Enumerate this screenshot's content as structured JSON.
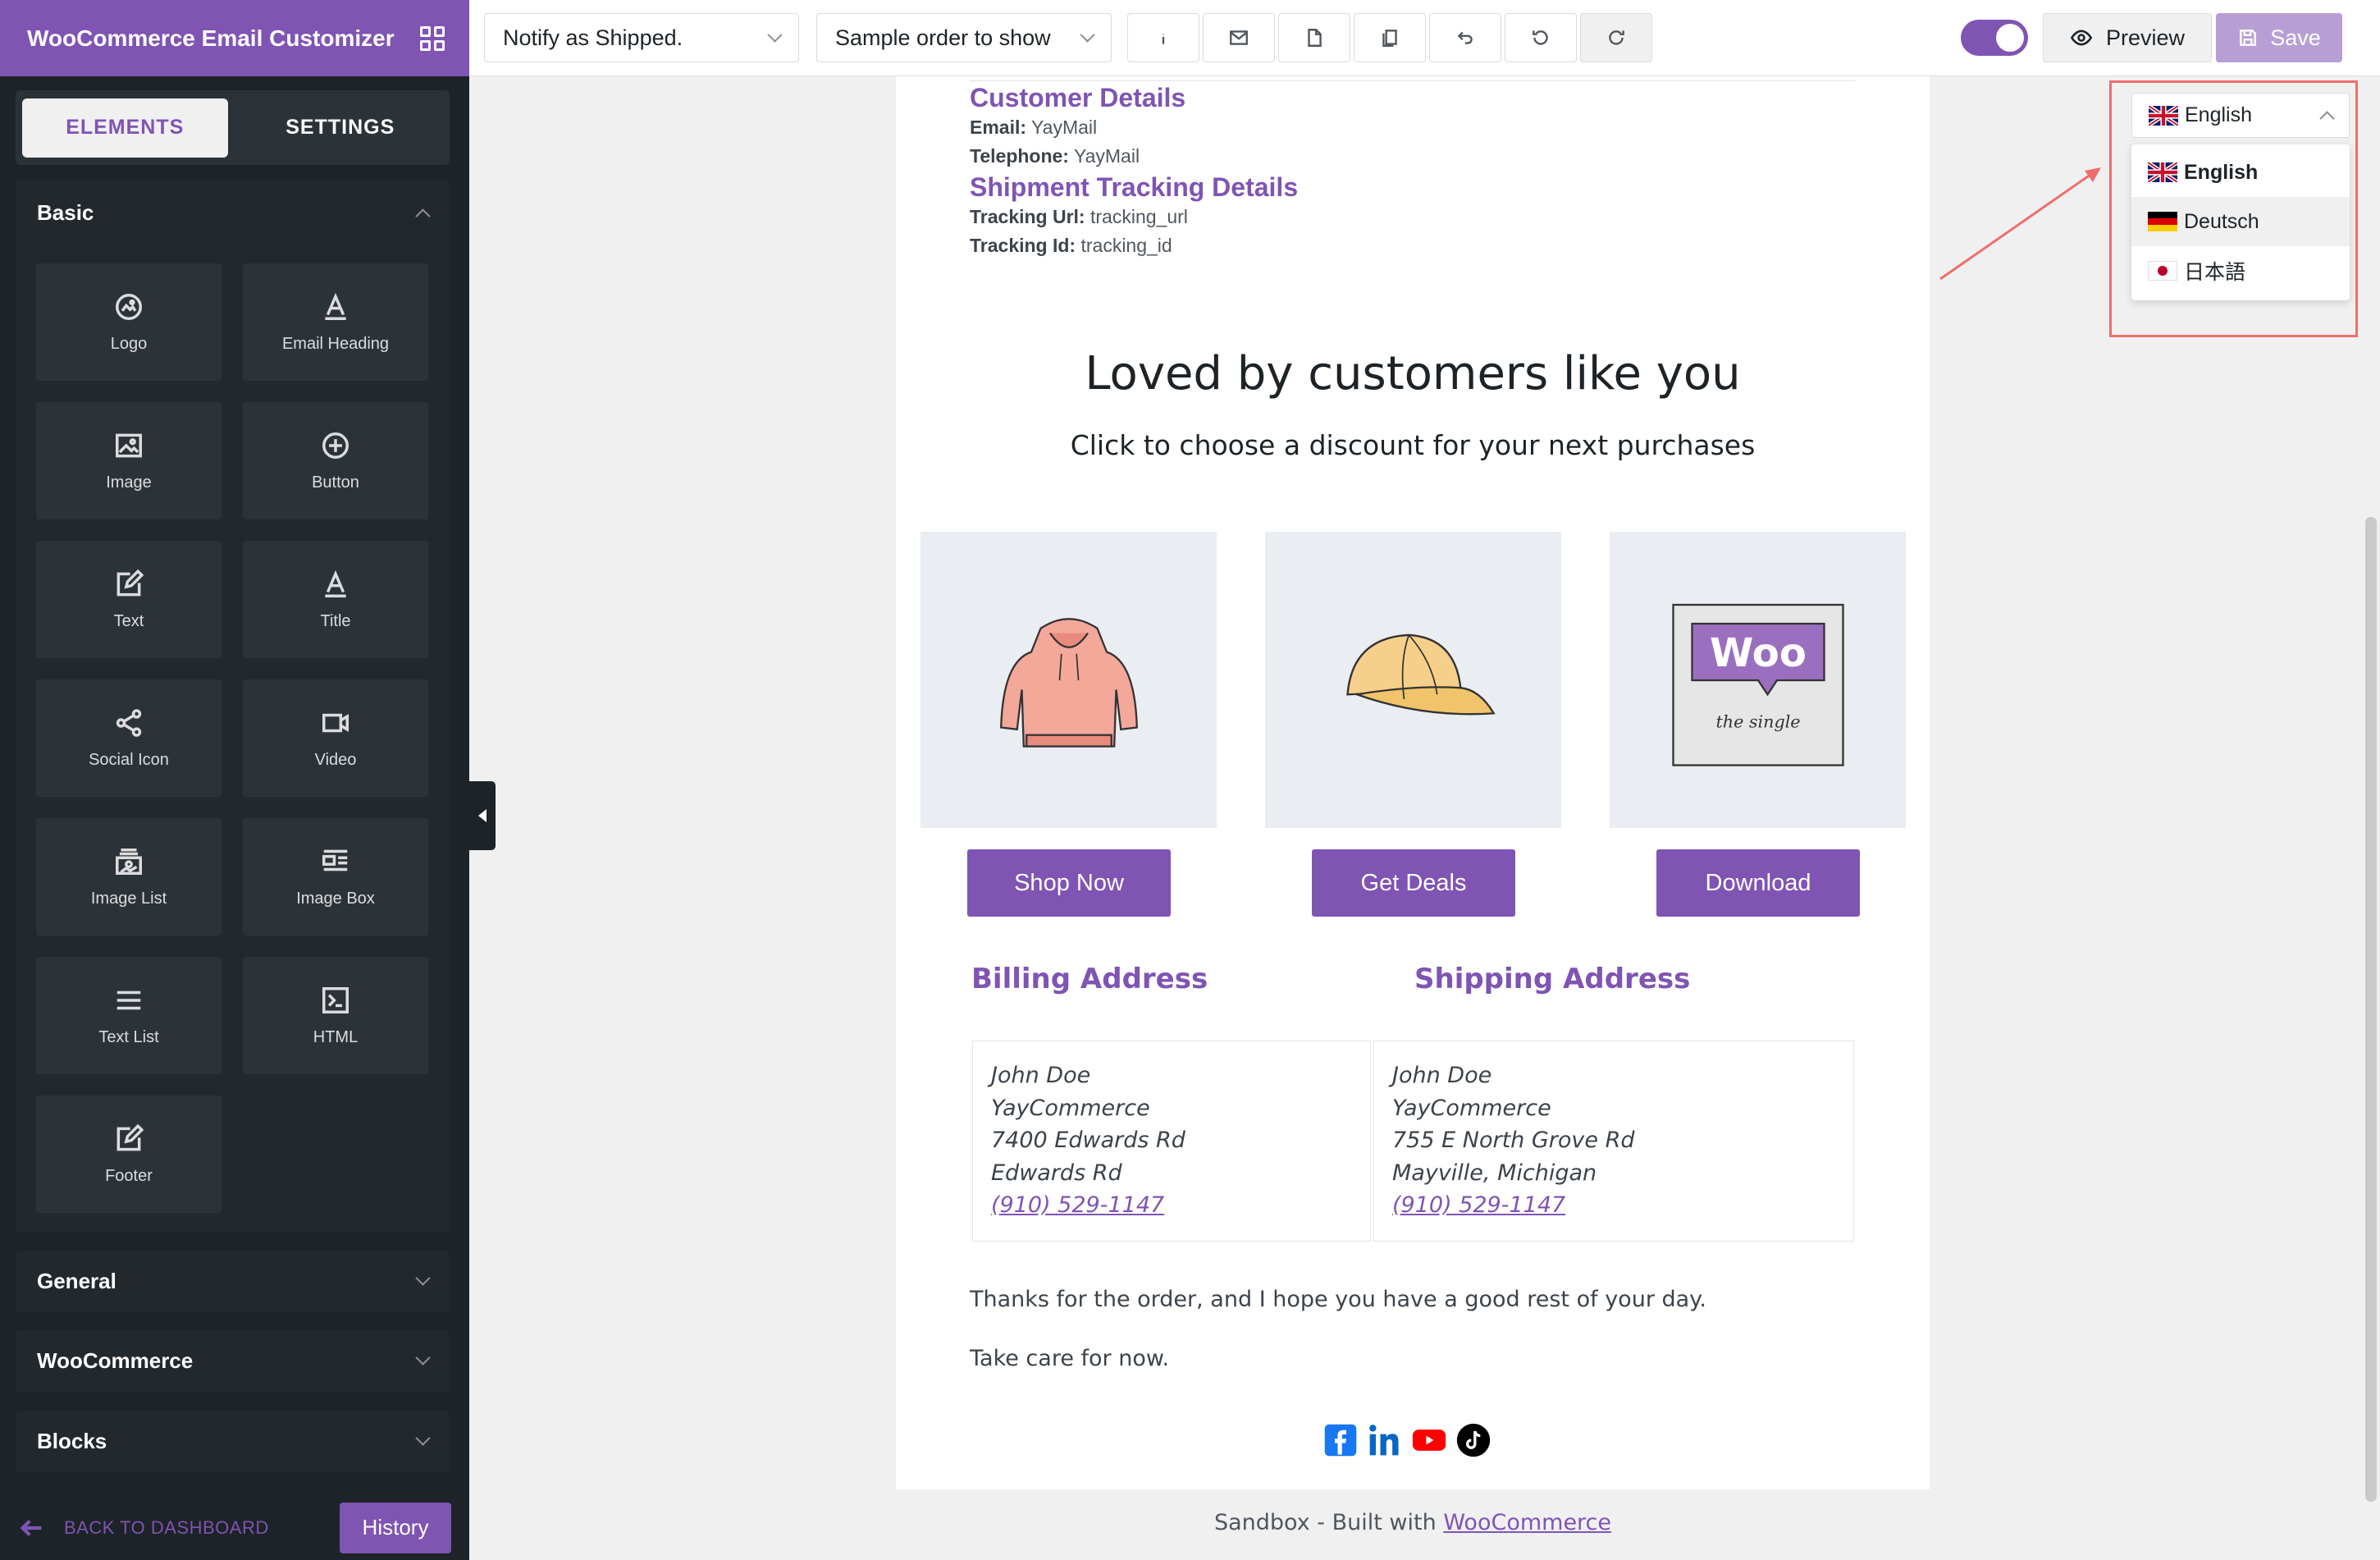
{
  "app": {
    "title": "WooCommerce Email Customizer"
  },
  "sidebar": {
    "tabs": [
      {
        "label": "ELEMENTS"
      },
      {
        "label": "SETTINGS"
      }
    ],
    "basic_title": "Basic",
    "elements": [
      {
        "label": "Logo",
        "icon": "logo-icon"
      },
      {
        "label": "Email Heading",
        "icon": "heading-icon"
      },
      {
        "label": "Image",
        "icon": "image-icon"
      },
      {
        "label": "Button",
        "icon": "button-icon"
      },
      {
        "label": "Text",
        "icon": "text-edit-icon"
      },
      {
        "label": "Title",
        "icon": "title-icon"
      },
      {
        "label": "Social Icon",
        "icon": "share-icon"
      },
      {
        "label": "Video",
        "icon": "video-icon"
      },
      {
        "label": "Image List",
        "icon": "image-list-icon"
      },
      {
        "label": "Image Box",
        "icon": "image-box-icon"
      },
      {
        "label": "Text List",
        "icon": "list-icon"
      },
      {
        "label": "HTML",
        "icon": "code-icon"
      },
      {
        "label": "Footer",
        "icon": "footer-edit-icon"
      }
    ],
    "sections": [
      {
        "label": "General"
      },
      {
        "label": "WooCommerce"
      },
      {
        "label": "Blocks"
      }
    ],
    "back_label": "BACK TO DASHBOARD",
    "history_label": "History"
  },
  "toolbar": {
    "template_select": "Notify as Shipped.",
    "order_select": "Sample order to show",
    "toggle_on": true,
    "preview_label": "Preview",
    "save_label": "Save"
  },
  "email": {
    "customer_title": "Customer Details",
    "email_label": "Email:",
    "email_value": "YayMail",
    "phone_label": "Telephone:",
    "phone_value": "YayMail",
    "shipment_title": "Shipment Tracking Details",
    "tracking_url_label": "Tracking Url:",
    "tracking_url_value": "tracking_url",
    "tracking_id_label": "Tracking Id:",
    "tracking_id_value": "tracking_id",
    "loved_title": "Loved by customers like you",
    "loved_subtitle": "Click to choose a discount for your next purchases",
    "products": [
      {
        "image": "hoodie-illustration",
        "button": "Shop Now"
      },
      {
        "image": "cap-illustration",
        "button": "Get Deals"
      },
      {
        "image": "woo-album-illustration",
        "button": "Download"
      }
    ],
    "woo_text": "Woo",
    "album_text": "the single",
    "billing_title": "Billing Address",
    "shipping_title": "Shipping Address",
    "billing": {
      "name": "John Doe",
      "company": "YayCommerce",
      "street": "7400 Edwards Rd",
      "city": "Edwards Rd",
      "phone": "(910) 529-1147"
    },
    "shipping": {
      "name": "John Doe",
      "company": "YayCommerce",
      "street": "755 E North Grove Rd",
      "city": "Mayville, Michigan",
      "phone": "(910) 529-1147"
    },
    "closing_1": "Thanks for the order, and I hope you have a good rest of your day.",
    "closing_2": "Take care for now.",
    "socials": [
      "facebook-icon",
      "linkedin-icon",
      "youtube-icon",
      "tiktok-icon"
    ]
  },
  "footer": {
    "prefix": "Sandbox - Built with",
    "link": "WooCommerce"
  },
  "language": {
    "selected": "English",
    "options": [
      {
        "label": "English",
        "flag": "uk"
      },
      {
        "label": "Deutsch",
        "flag": "de"
      },
      {
        "label": "日本語",
        "flag": "jp"
      }
    ]
  },
  "colors": {
    "brand": "#7f54b3",
    "sidebar_bg": "#1d2327",
    "annotation": "#f06d6d"
  }
}
